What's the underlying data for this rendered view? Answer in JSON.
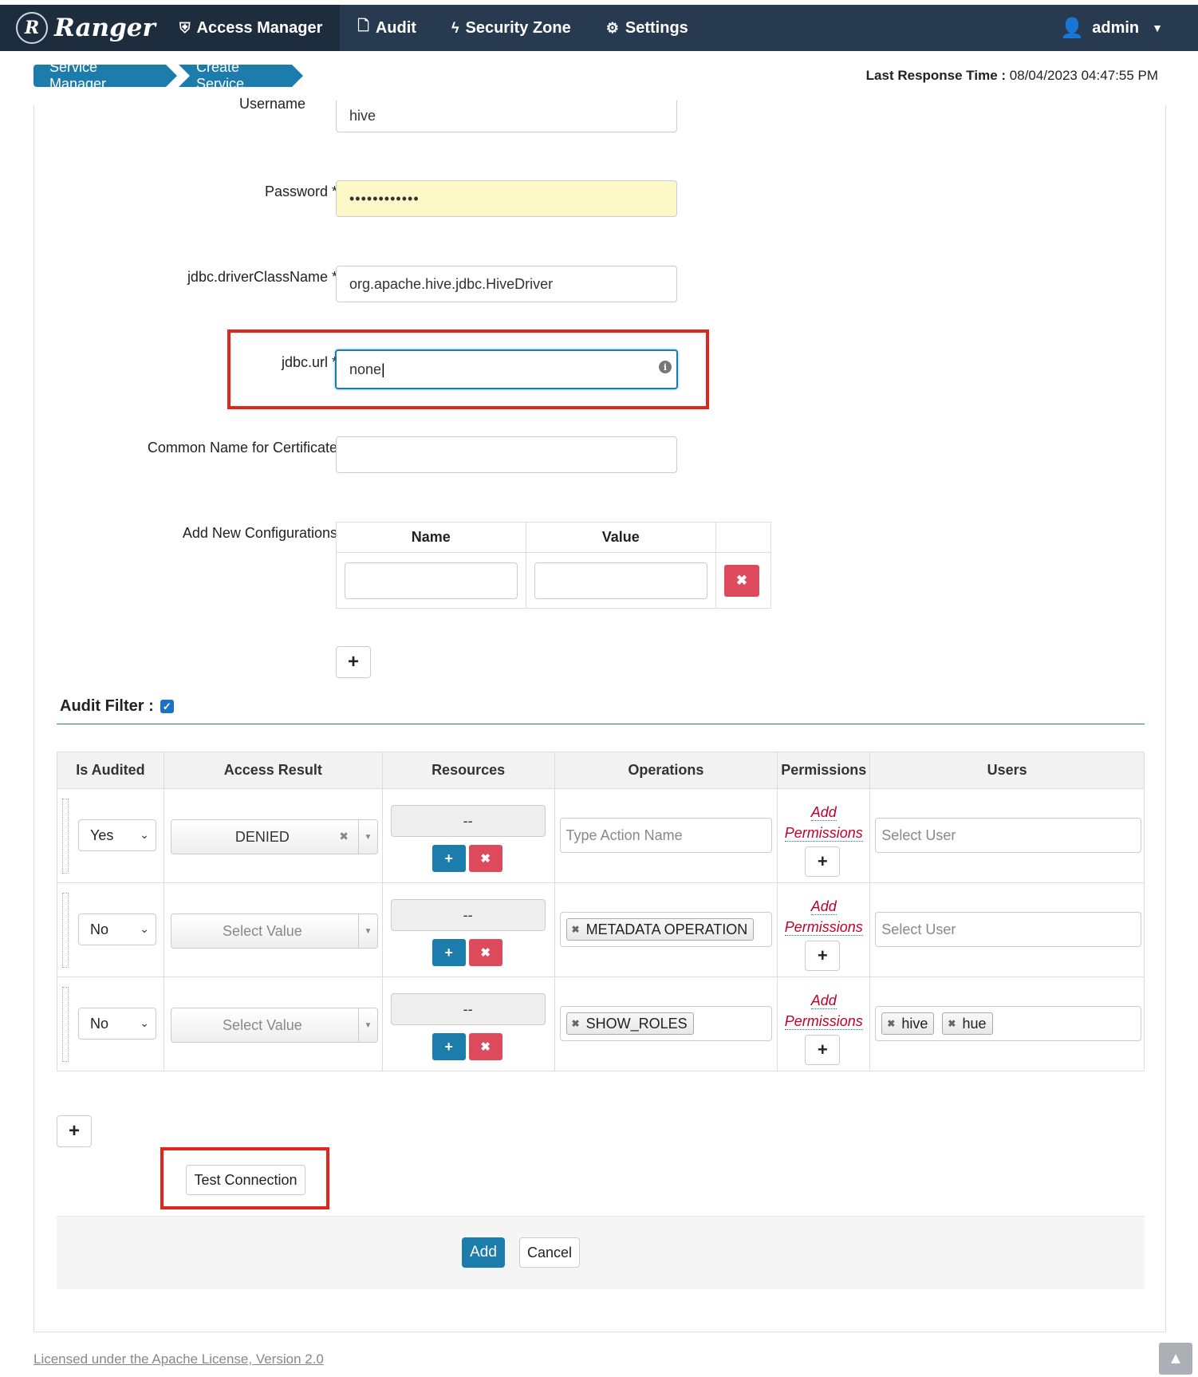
{
  "navbar": {
    "brand": "Ranger",
    "brand_logo": "R",
    "items": [
      {
        "label": "Access Manager",
        "icon": "shield-icon"
      },
      {
        "label": "Audit",
        "icon": "file-icon"
      },
      {
        "label": "Security Zone",
        "icon": "bolt-icon"
      },
      {
        "label": "Settings",
        "icon": "gear-icon"
      }
    ],
    "user": "admin"
  },
  "breadcrumb": [
    "Service Manager",
    "Create Service"
  ],
  "last_response": {
    "label": "Last Response Time :",
    "value": "08/04/2023 04:47:55 PM"
  },
  "form": {
    "username": {
      "label": "Username",
      "value": "hive"
    },
    "password": {
      "label": "Password *",
      "value": "••••••••••••"
    },
    "driver": {
      "label": "jdbc.driverClassName *",
      "value": "org.apache.hive.jdbc.HiveDriver"
    },
    "url": {
      "label": "jdbc.url *",
      "value": "none"
    },
    "cn": {
      "label": "Common Name for Certificate",
      "value": ""
    },
    "new_config": {
      "label": "Add New Configurations",
      "col_name": "Name",
      "col_value": "Value"
    }
  },
  "audit_filter": {
    "title": "Audit Filter :",
    "columns": [
      "Is Audited",
      "Access Result",
      "Resources",
      "Operations",
      "Permissions",
      "Users"
    ],
    "add_permissions": "Add Permissions",
    "rows": [
      {
        "is_audited": "Yes",
        "access_result": "DENIED",
        "resource": "--",
        "operations_placeholder": "Type Action Name",
        "operation_tag": "",
        "users_placeholder": "Select User",
        "user_tags": []
      },
      {
        "is_audited": "No",
        "access_result": "Select Value",
        "resource": "--",
        "operations_placeholder": "",
        "operation_tag": "METADATA OPERATION",
        "users_placeholder": "Select User",
        "user_tags": []
      },
      {
        "is_audited": "No",
        "access_result": "Select Value",
        "resource": "--",
        "operations_placeholder": "",
        "operation_tag": "SHOW_ROLES",
        "users_placeholder": "",
        "user_tags": [
          "hive",
          "hue"
        ]
      }
    ]
  },
  "buttons": {
    "test_connection": "Test Connection",
    "add": "Add",
    "cancel": "Cancel"
  },
  "footer": {
    "license": "Licensed under the Apache License, Version 2.0"
  },
  "colors": {
    "navbar": "#273a4f",
    "accent": "#1c7dad",
    "danger": "#dc4a5c",
    "highlight": "#e0261b"
  }
}
